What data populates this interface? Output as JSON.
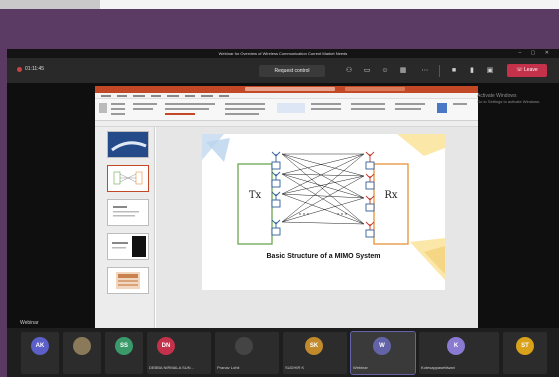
{
  "window_title": "Webinar for Overview of Wireless Communication Current Market Needs",
  "toolbar": {
    "recording": "01:11:45",
    "request_control": "Request control",
    "leave": "Leave"
  },
  "slide": {
    "tx_label": "Tx",
    "rx_label": "Rx",
    "caption": "Basic Structure of a MIMO System"
  },
  "shared_by": "Webinar",
  "watermark": {
    "line1": "Activate Windows",
    "line2": "Go to Settings to activate Windows."
  },
  "participants": [
    {
      "initials": "AK",
      "name": "",
      "color": "#5b5fc7"
    },
    {
      "initials": "",
      "name": "",
      "color": "#8a7a5a"
    },
    {
      "initials": "SS",
      "name": "",
      "color": "#3a9a6a"
    },
    {
      "initials": "DN",
      "name": "DEBBA NIRMALA SUN...",
      "color": "#c4314b"
    },
    {
      "initials": "",
      "name": "Pranav Lohit",
      "color": "#444444"
    },
    {
      "initials": "SK",
      "name": "SUDHIR K",
      "color": "#c28a2a"
    },
    {
      "initials": "W",
      "name": "Webinar",
      "color": "#6264a7"
    },
    {
      "initials": "K",
      "name": "Kotesappasettiwari",
      "color": "#8a7ad1"
    },
    {
      "initials": "ST",
      "name": "",
      "color": "#d9a21b"
    }
  ]
}
